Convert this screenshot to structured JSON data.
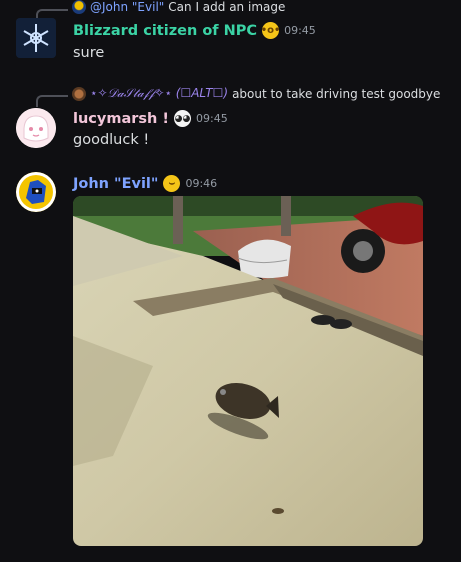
{
  "messages": [
    {
      "reply": {
        "author": "@John \"Evil\"",
        "text": "Can I add an image"
      },
      "author": "Blizzard citizen of NPC",
      "author_color": "#3bd3a5",
      "badge_emoji": "flushed-face",
      "timestamp": "09:45",
      "content": "sure"
    },
    {
      "reply": {
        "author": "⋆✧𝒟𝒶𝒮𝓉𝒶𝒻𝒻✧⋆ (☐ALT☐)",
        "author_color": "#9b84ec",
        "text": "about to take driving test goodbye"
      },
      "author": "lucymarsh !",
      "author_color": "#f2c6d9",
      "badge_emoji": "white-face-emoji",
      "timestamp": "09:45",
      "content": "goodluck !"
    },
    {
      "author": "John \"Evil\"",
      "author_color": "#7ea3ff",
      "badge_emoji": "smirking-face",
      "timestamp": "09:46",
      "attachment": "photo: tiled courtyard with a fish on the ground, moped and shoes in background"
    }
  ]
}
